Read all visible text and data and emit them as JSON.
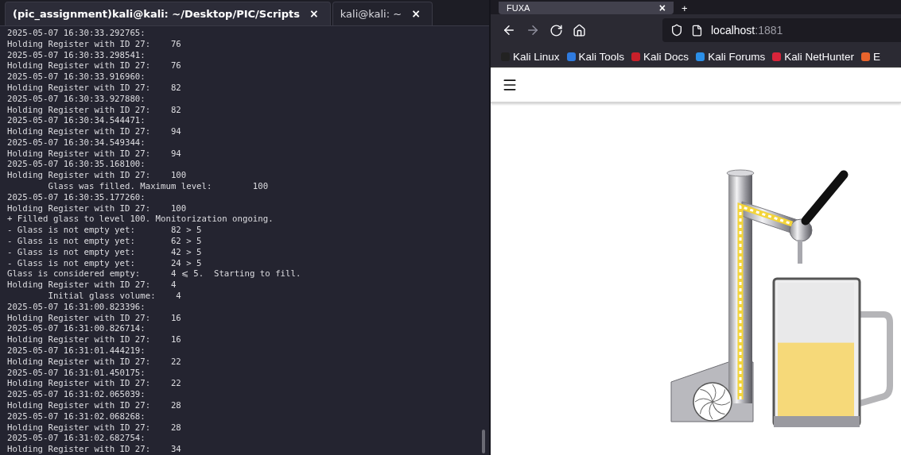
{
  "terminal": {
    "tabs": [
      {
        "label": "(pic_assignment)kali@kali: ~/Desktop/PIC/Scripts",
        "close": "×",
        "selected": true
      },
      {
        "label": "kali@kali: ~",
        "close": "×",
        "selected": false
      }
    ],
    "lines": [
      "2025-05-07 16:30:33.292765:",
      "Holding Register with ID 27:    76",
      "2025-05-07 16:30:33.298541:",
      "Holding Register with ID 27:    76",
      "2025-05-07 16:30:33.916960:",
      "Holding Register with ID 27:    82",
      "2025-05-07 16:30:33.927880:",
      "Holding Register with ID 27:    82",
      "2025-05-07 16:30:34.544471:",
      "Holding Register with ID 27:    94",
      "2025-05-07 16:30:34.549344:",
      "Holding Register with ID 27:    94",
      "2025-05-07 16:30:35.168100:",
      "Holding Register with ID 27:    100",
      "        Glass was filled. Maximum level:        100",
      "2025-05-07 16:30:35.177260:",
      "Holding Register with ID 27:    100",
      "+ Filled glass to level 100. Monitorization ongoing.",
      "- Glass is not empty yet:       82 > 5",
      "- Glass is not empty yet:       62 > 5",
      "- Glass is not empty yet:       42 > 5",
      "- Glass is not empty yet:       24 > 5",
      "Glass is considered empty:      4 ⩽ 5.  Starting to fill.",
      "Holding Register with ID 27:    4",
      "        Initial glass volume:    4",
      "2025-05-07 16:31:00.823396:",
      "Holding Register with ID 27:    16",
      "2025-05-07 16:31:00.826714:",
      "Holding Register with ID 27:    16",
      "2025-05-07 16:31:01.444219:",
      "Holding Register with ID 27:    22",
      "2025-05-07 16:31:01.450175:",
      "Holding Register with ID 27:    22",
      "2025-05-07 16:31:02.065039:",
      "Holding Register with ID 27:    28",
      "2025-05-07 16:31:02.068268:",
      "Holding Register with ID 27:    28",
      "2025-05-07 16:31:02.682754:",
      "Holding Register with ID 27:    34"
    ]
  },
  "browser": {
    "tab": {
      "title": "FUXA",
      "close": "×"
    },
    "new_tab": "+",
    "address": {
      "host": "localhost",
      "port": ":1881"
    },
    "bookmarks": [
      {
        "label": "Kali Linux"
      },
      {
        "label": "Kali Tools"
      },
      {
        "label": "Kali Docs"
      },
      {
        "label": "Kali Forums"
      },
      {
        "label": "Kali NetHunter"
      },
      {
        "label": "E"
      }
    ],
    "page": {
      "glass": {
        "level": 0.55
      }
    }
  }
}
